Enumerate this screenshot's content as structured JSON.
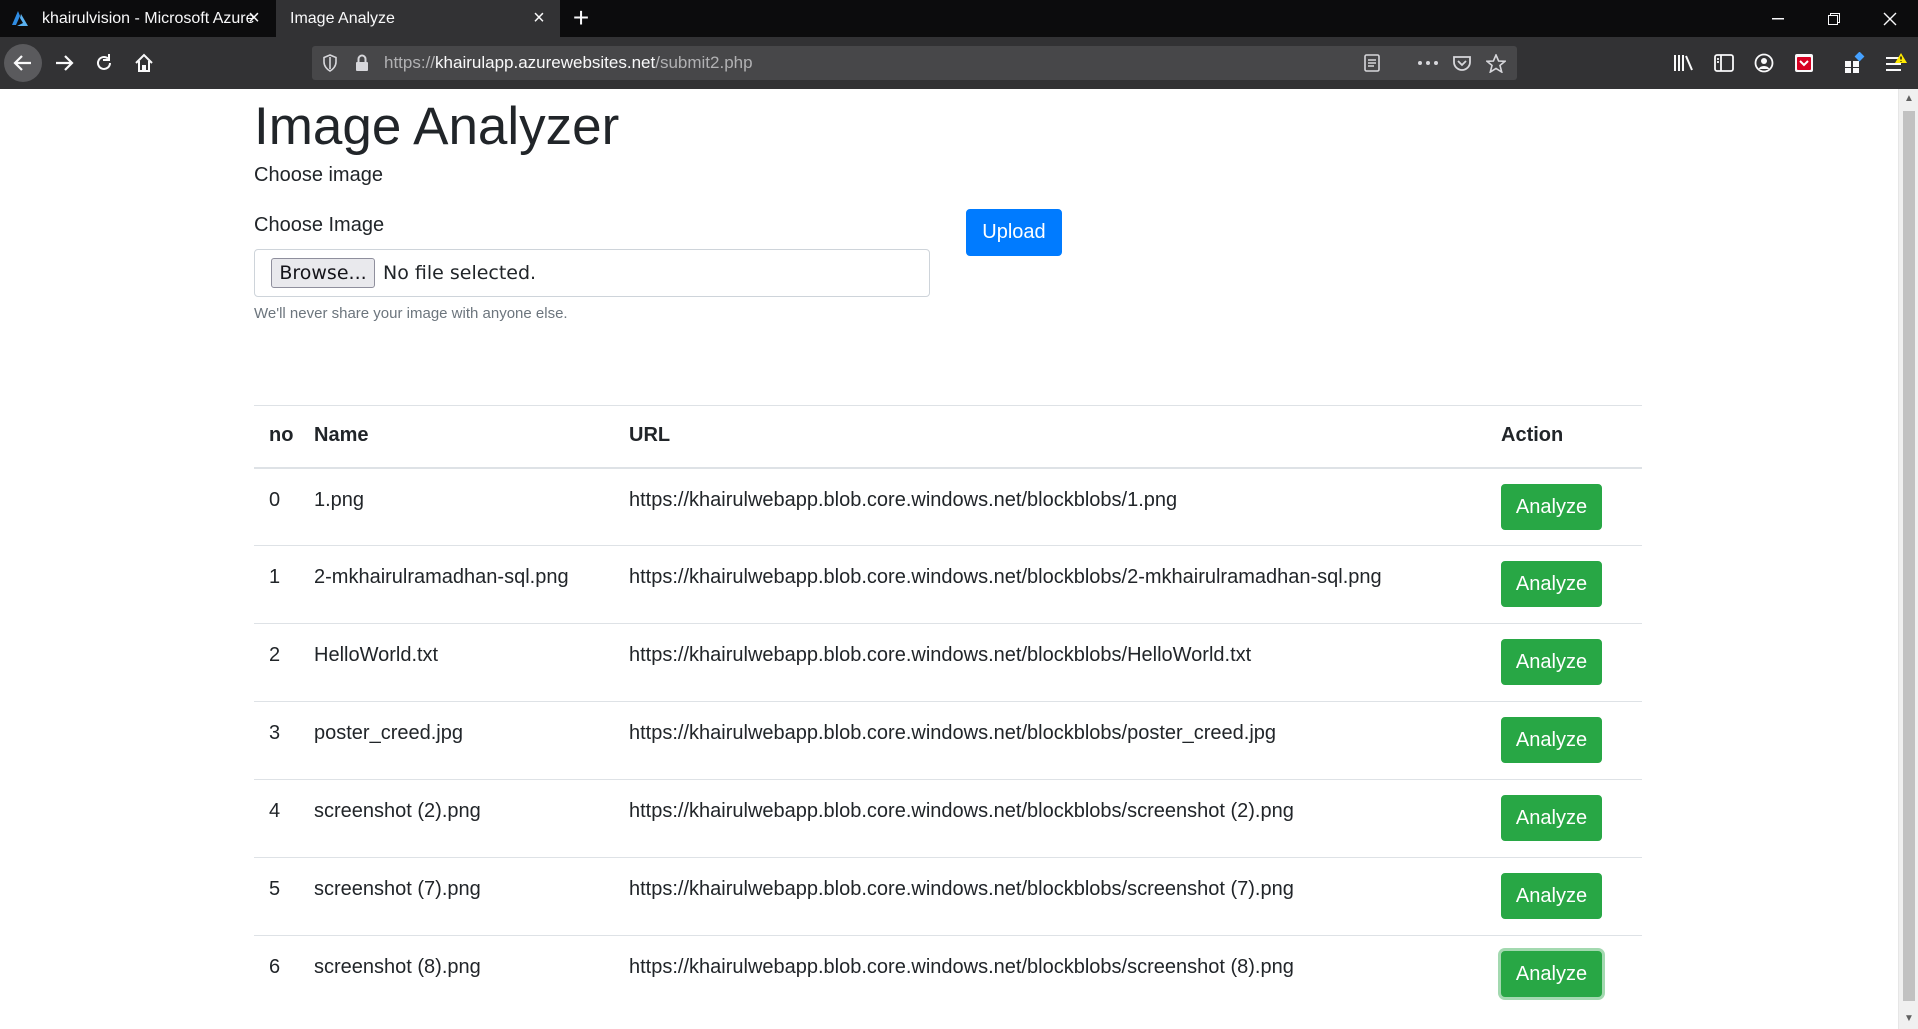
{
  "browser": {
    "tabs": [
      {
        "title": "khairulvision - Microsoft Azure",
        "favicon": "azure-icon",
        "active": false
      },
      {
        "title": "Image Analyze",
        "favicon": "",
        "active": true
      }
    ],
    "url_scheme": "https://",
    "url_host": "khairulapp.azurewebsites.net",
    "url_path": "/submit2.php"
  },
  "page": {
    "title": "Image Analyzer",
    "choose_heading": "Choose image",
    "field_label": "Choose Image",
    "browse_label": "Browse...",
    "file_status": "No file selected.",
    "help_text": "We'll never share your image with anyone else.",
    "upload_label": "Upload"
  },
  "table": {
    "headers": {
      "no": "no",
      "name": "Name",
      "url": "URL",
      "action": "Action"
    },
    "rows": [
      {
        "no": "0",
        "name": "1.png",
        "url": "https://khairulwebapp.blob.core.windows.net/blockblobs/1.png",
        "action": "Analyze"
      },
      {
        "no": "1",
        "name": "2-mkhairulramadhan-sql.png",
        "url": "https://khairulwebapp.blob.core.windows.net/blockblobs/2-mkhairulramadhan-sql.png",
        "action": "Analyze"
      },
      {
        "no": "2",
        "name": "HelloWorld.txt",
        "url": "https://khairulwebapp.blob.core.windows.net/blockblobs/HelloWorld.txt",
        "action": "Analyze"
      },
      {
        "no": "3",
        "name": "poster_creed.jpg",
        "url": "https://khairulwebapp.blob.core.windows.net/blockblobs/poster_creed.jpg",
        "action": "Analyze"
      },
      {
        "no": "4",
        "name": "screenshot (2).png",
        "url": "https://khairulwebapp.blob.core.windows.net/blockblobs/screenshot (2).png",
        "action": "Analyze"
      },
      {
        "no": "5",
        "name": "screenshot (7).png",
        "url": "https://khairulwebapp.blob.core.windows.net/blockblobs/screenshot (7).png",
        "action": "Analyze"
      },
      {
        "no": "6",
        "name": "screenshot (8).png",
        "url": "https://khairulwebapp.blob.core.windows.net/blockblobs/screenshot (8).png",
        "action": "Analyze"
      }
    ]
  },
  "colors": {
    "primary": "#007bff",
    "success": "#28a745",
    "chrome_dark": "#0c0c0d",
    "toolbar": "#323234"
  }
}
